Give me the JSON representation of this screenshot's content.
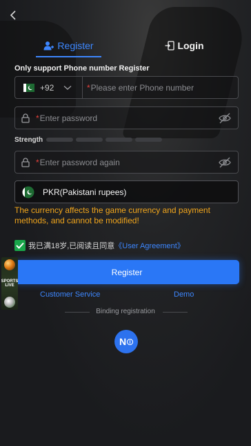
{
  "tabs": {
    "register": "Register",
    "login": "Login"
  },
  "form": {
    "hint": "Only support Phone number Register",
    "phone": {
      "country_code": "+92",
      "required_mark": "*",
      "placeholder": "Please enter Phone number"
    },
    "password": {
      "required_mark": "*",
      "placeholder": "Enter password"
    },
    "strength_label": "Strength",
    "strength_level": 0,
    "password_again": {
      "required_mark": "*",
      "placeholder": "Enter password again"
    },
    "currency": {
      "value": "PKR(Pakistani rupees)"
    },
    "currency_warning": "The currency affects the game currency and payment methods, and cannot be modified!",
    "agreement": {
      "checked": true,
      "text": "我已满18岁,已阅读且同意",
      "link": "《User Agreement》"
    },
    "register_button": "Register"
  },
  "links": {
    "customer_service": "Customer Service",
    "demo": "Demo"
  },
  "binding": {
    "label": "Binding registration",
    "button": "N"
  },
  "promo": {
    "text": "SPORTS LIVE"
  },
  "icons": {
    "back": "chevron-left-icon",
    "register_tab": "user-add-icon",
    "login_tab": "login-door-icon",
    "lock": "lock-icon",
    "eye_off": "eye-off-icon",
    "flag": "pakistan-flag-icon",
    "chevron": "chevron-down-icon",
    "check": "check-icon"
  },
  "colors": {
    "accent": "#3d87ff",
    "button": "#2a77f6",
    "warning": "#f2a61c",
    "required": "#e5413c",
    "check": "#19a64a"
  }
}
